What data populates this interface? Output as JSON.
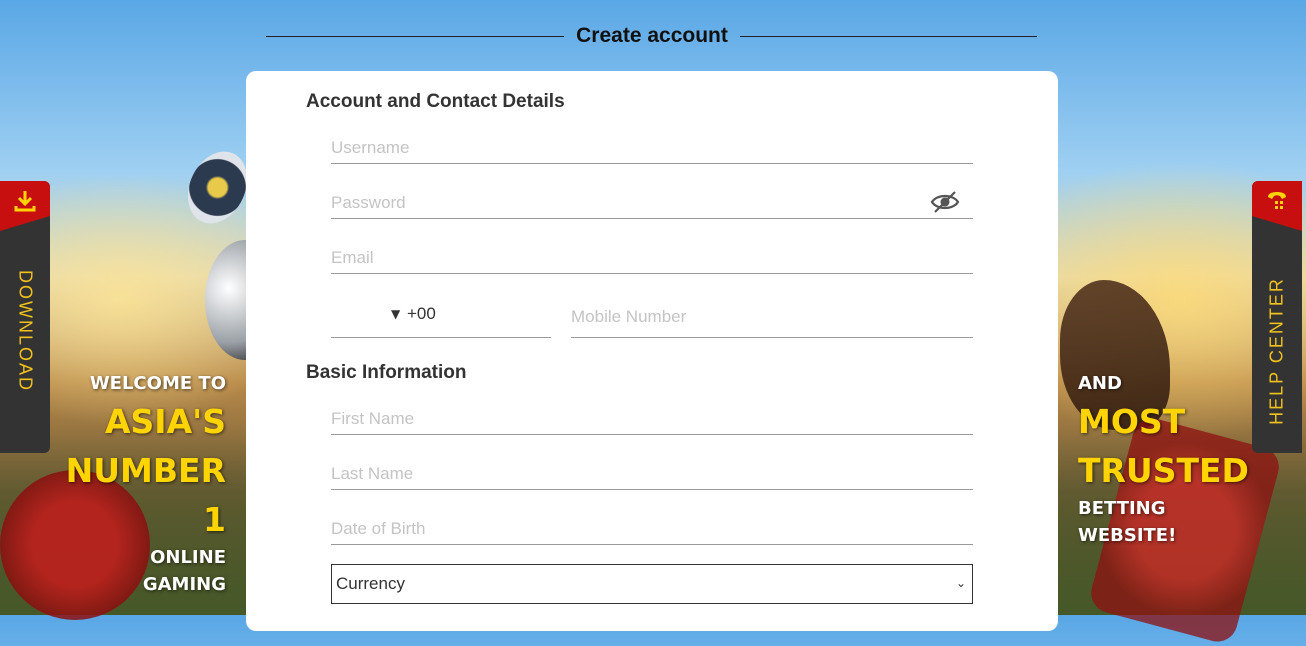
{
  "header": {
    "title": "Create account"
  },
  "form": {
    "section_account": "Account and Contact Details",
    "username_placeholder": "Username",
    "password_placeholder": "Password",
    "email_placeholder": "Email",
    "country_code": "+00",
    "mobile_placeholder": "Mobile Number",
    "section_basic": "Basic Information",
    "first_name_placeholder": "First Name",
    "last_name_placeholder": "Last Name",
    "dob_placeholder": "Date of Birth",
    "currency_selected": "Currency"
  },
  "side_tabs": {
    "download_label": "DOWNLOAD",
    "help_label": "HELP CENTER"
  },
  "promo": {
    "left_line1": "WELCOME TO",
    "left_line2": "ASIA'S",
    "left_line3": "NUMBER",
    "left_line4": "1",
    "left_line5": "ONLINE",
    "left_line6": "GAMING",
    "right_line1": "AND",
    "right_line2": "MOST",
    "right_line3": "TRUSTED",
    "right_line4": "BETTING",
    "right_line5": "WEBSITE!"
  },
  "colors": {
    "accent_red": "#c80f0f",
    "accent_yellow": "#ffd400",
    "tab_bg": "#333333"
  }
}
